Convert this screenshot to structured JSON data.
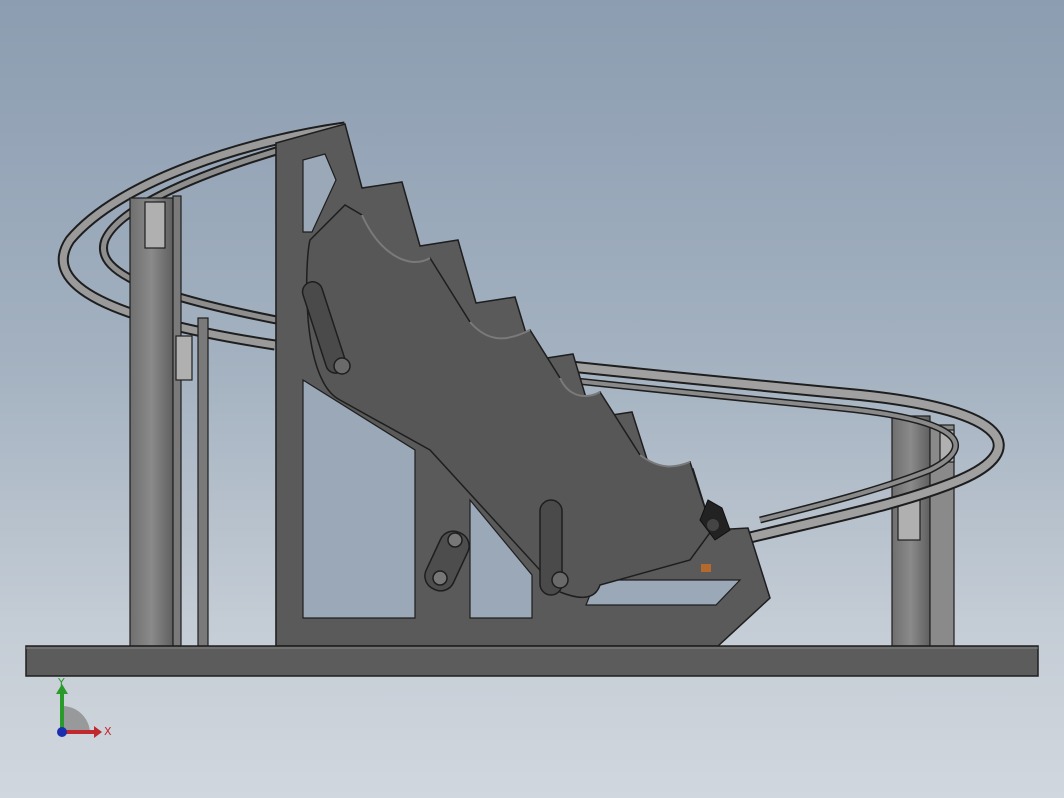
{
  "viewport": {
    "background_top": "#8c9db1",
    "background_bottom": "#d1d7de",
    "model": {
      "part_color": "#5a5a5a",
      "rail_color": "#8e8e8e",
      "edge_color": "#1e1e1e",
      "highlight_color": "#b8b8b8",
      "detail_color": "#b5692d"
    }
  },
  "triad": {
    "x_label": "X",
    "y_label": "Y",
    "x_color": "#c0282d",
    "y_color": "#2a9a2a",
    "z_color": "#1a2fb0"
  }
}
